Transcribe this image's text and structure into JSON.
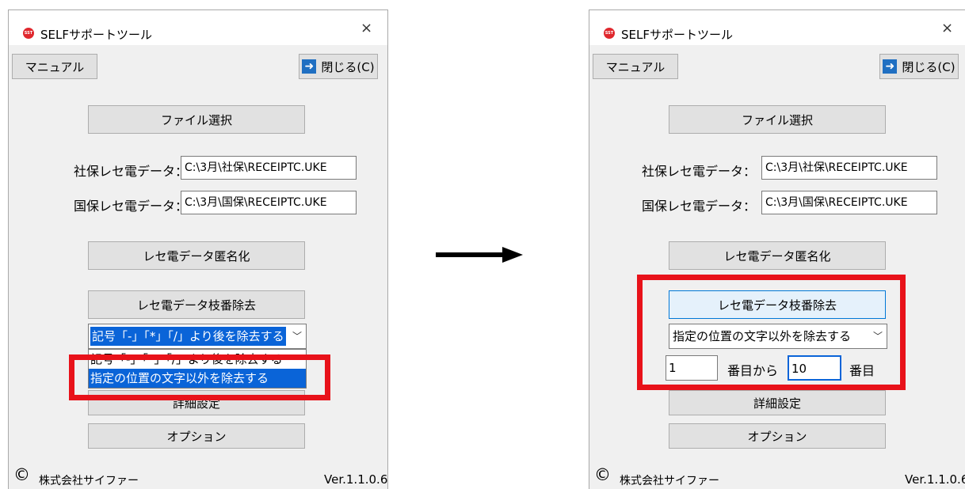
{
  "left": {
    "title": "SELFサポートツール",
    "close_glyph": "×",
    "manual_label": "マニュアル",
    "close_label": "閉じる(C)",
    "file_select_label": "ファイル選択",
    "shaho_label": "社保レセ電データ：",
    "shaho_value": "C:\\3月\\社保\\RECEIPTC.UKE",
    "kokuho_label": "国保レセ電データ：",
    "kokuho_value": "C:\\3月\\国保\\RECEIPTC.UKE",
    "anonymize_label": "レセ電データ匿名化",
    "branch_remove_label": "レセ電データ枝番除去",
    "select_value": "記号「-」「*」「/」より後を除去する",
    "options": [
      "記号「-」「*」「/」より後を除去する",
      "指定の位置の文字以外を除去する"
    ],
    "details_label": "詳細設定",
    "option_label": "オプション",
    "copyright": "©",
    "company": "株式会社サイファー",
    "version": "Ver.1.1.0.6"
  },
  "right": {
    "title": "SELFサポートツール",
    "close_glyph": "×",
    "manual_label": "マニュアル",
    "close_label": "閉じる(C)",
    "file_select_label": "ファイル選択",
    "shaho_label": "社保レセ電データ：",
    "shaho_value": "C:\\3月\\社保\\RECEIPTC.UKE",
    "kokuho_label": "国保レセ電データ：",
    "kokuho_value": "C:\\3月\\国保\\RECEIPTC.UKE",
    "anonymize_label": "レセ電データ匿名化",
    "branch_remove_label": "レセ電データ枝番除去",
    "select_value": "指定の位置の文字以外を除去する",
    "from_value": "1",
    "from_label": "番目から",
    "to_value": "10",
    "to_label": "番目",
    "details_label": "詳細設定",
    "option_label": "オプション",
    "copyright": "©",
    "company": "株式会社サイファー",
    "version": "Ver.1.1.0.6"
  },
  "icons": [
    "app-logo-icon",
    "close-icon",
    "exit-arrow-icon",
    "dropdown-chevron-icon",
    "transition-arrow-icon"
  ],
  "app_icon_text": "SST",
  "colors": {
    "highlight": "#e8121a",
    "selection": "#0a64d8",
    "window_bg": "#f0f0f0",
    "button_bg": "#e1e1e1"
  }
}
